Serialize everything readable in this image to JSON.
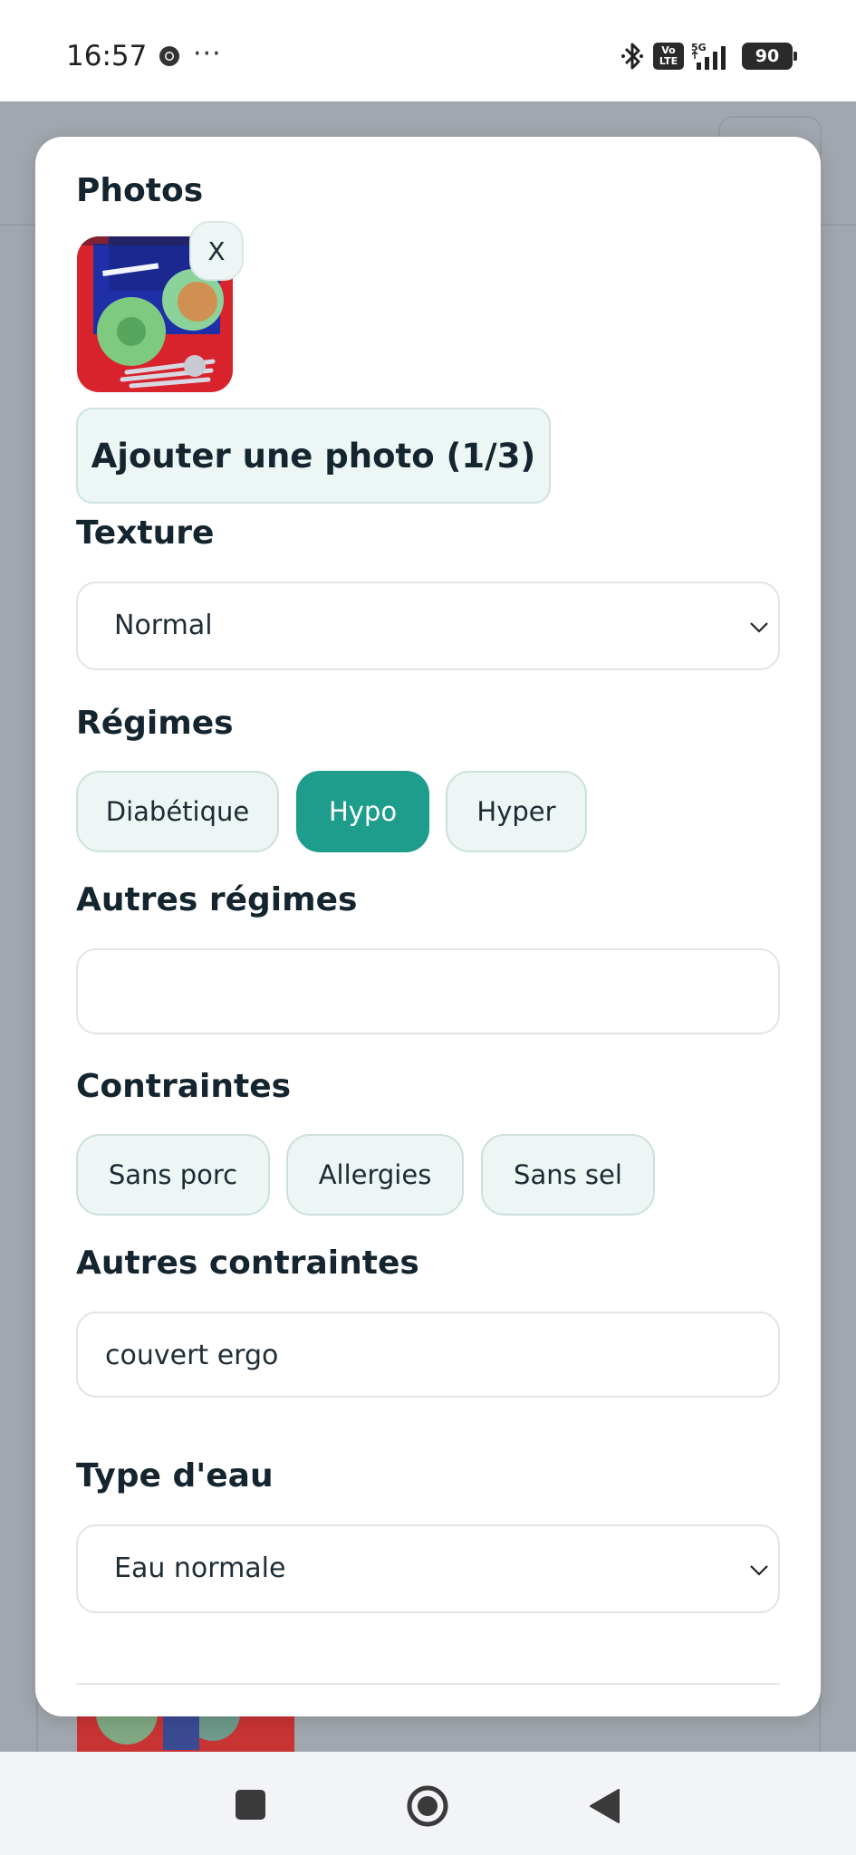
{
  "status_bar": {
    "time": "16:57",
    "overflow": "···",
    "volte_top": "Vo",
    "volte_bottom": "LTE",
    "network": "5G",
    "battery": "90",
    "icons": [
      "chrome-icon",
      "bluetooth-icon",
      "volte-icon",
      "signal-icon",
      "battery-icon"
    ]
  },
  "modal": {
    "photos": {
      "label": "Photos",
      "remove_label": "X",
      "add_button": "Ajouter une photo (1/3)"
    },
    "texture": {
      "label": "Texture",
      "selected": "Normal"
    },
    "regimes": {
      "label": "Régimes",
      "options": [
        {
          "label": "Diabétique",
          "selected": false
        },
        {
          "label": "Hypo",
          "selected": true
        },
        {
          "label": "Hyper",
          "selected": false
        }
      ]
    },
    "autres_regimes": {
      "label": "Autres régimes",
      "value": ""
    },
    "contraintes": {
      "label": "Contraintes",
      "options": [
        {
          "label": "Sans porc",
          "selected": false
        },
        {
          "label": "Allergies",
          "selected": false
        },
        {
          "label": "Sans sel",
          "selected": false
        }
      ]
    },
    "autres_contraintes": {
      "label": "Autres contraintes",
      "value": "couvert ergo"
    },
    "type_eau": {
      "label": "Type d'eau",
      "selected": "Eau normale"
    }
  },
  "colors": {
    "accent": "#1e9c8c",
    "chip_bg": "#edf6f5",
    "backdrop": "#a1a7ae",
    "text": "#14252f"
  },
  "nav_bar": {
    "icons": [
      "recent-apps-icon",
      "home-icon",
      "back-icon"
    ]
  }
}
